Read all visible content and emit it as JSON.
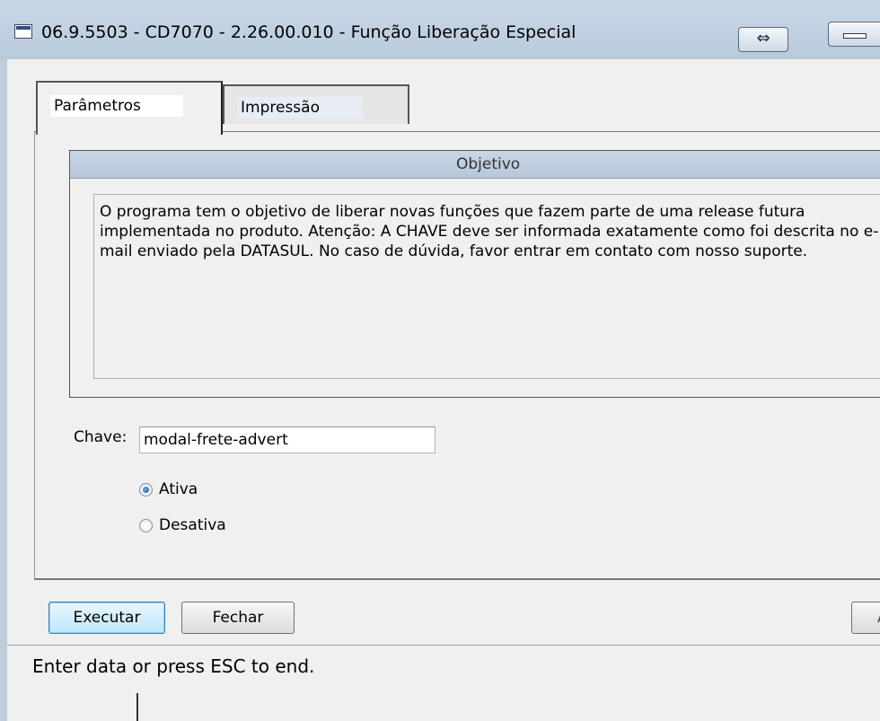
{
  "window": {
    "title": "06.9.5503 - CD7070 - 2.26.00.010 - Função Liberação Especial",
    "restore_glyph": "⇔"
  },
  "tabs": [
    {
      "label": "Parâmetros",
      "active": true
    },
    {
      "label": "Impressão",
      "active": false
    }
  ],
  "objetivo": {
    "header": "Objetivo",
    "text": "O programa tem o objetivo de liberar novas funções que fazem parte de uma release futura implementada no produto. Atenção: A CHAVE deve ser informada exatamente como foi descrita no e-mail enviado pela DATASUL. No caso de dúvida, favor entrar em contato com nosso suporte."
  },
  "chave": {
    "label": "Chave:",
    "value": "modal-frete-advert"
  },
  "radios": [
    {
      "label": "Ativa",
      "checked": true
    },
    {
      "label": "Desativa",
      "checked": false
    }
  ],
  "buttons": {
    "executar": "Executar",
    "fechar": "Fechar",
    "ajuda_partial": "A"
  },
  "status": {
    "text": "Enter data or press ESC to end."
  }
}
